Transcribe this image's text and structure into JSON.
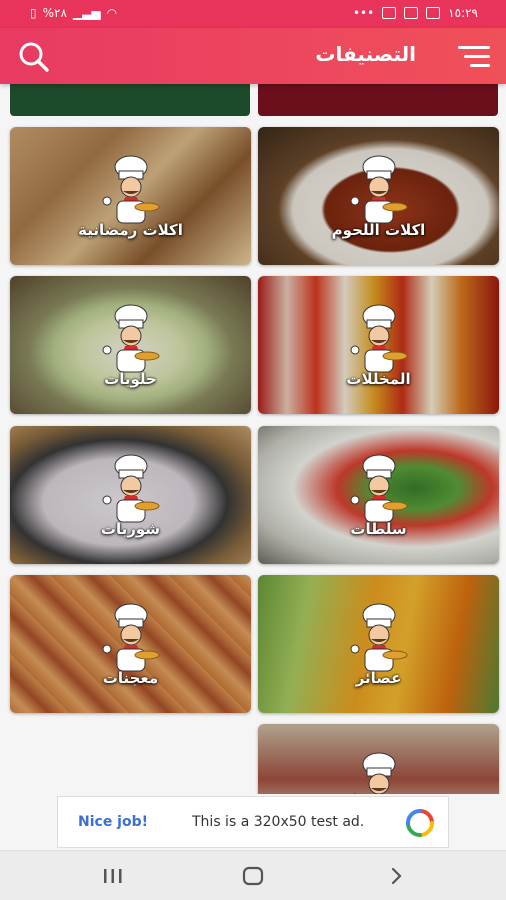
{
  "status_bar": {
    "battery": "%٢٨",
    "time": "١٥:٢٩",
    "dots": "•••"
  },
  "app_bar": {
    "title": "التصنيفات",
    "icons": [
      "search-icon",
      "menu-icon"
    ]
  },
  "categories": [
    {
      "label": "اكلات اللحوم",
      "photo": "meat-stew"
    },
    {
      "label": "اكلات رمضانية",
      "photo": "samosas"
    },
    {
      "label": "المخللات",
      "photo": "pickle-jars"
    },
    {
      "label": "حلويات",
      "photo": "dessert-bowl"
    },
    {
      "label": "سلطات",
      "photo": "salad"
    },
    {
      "label": "شوربات",
      "photo": "soup-bowl"
    },
    {
      "label": "عصائر",
      "photo": "juice-glasses"
    },
    {
      "label": "معجنات",
      "photo": "pastries"
    },
    {
      "label": "",
      "photo": "mixed"
    }
  ],
  "ad": {
    "nice": "Nice job!",
    "text": "This is a 320x50 test ad."
  },
  "colors": {
    "accent": "#e8335a",
    "strip_left": "#1d4a2a",
    "strip_right": "#6b0f1c"
  }
}
